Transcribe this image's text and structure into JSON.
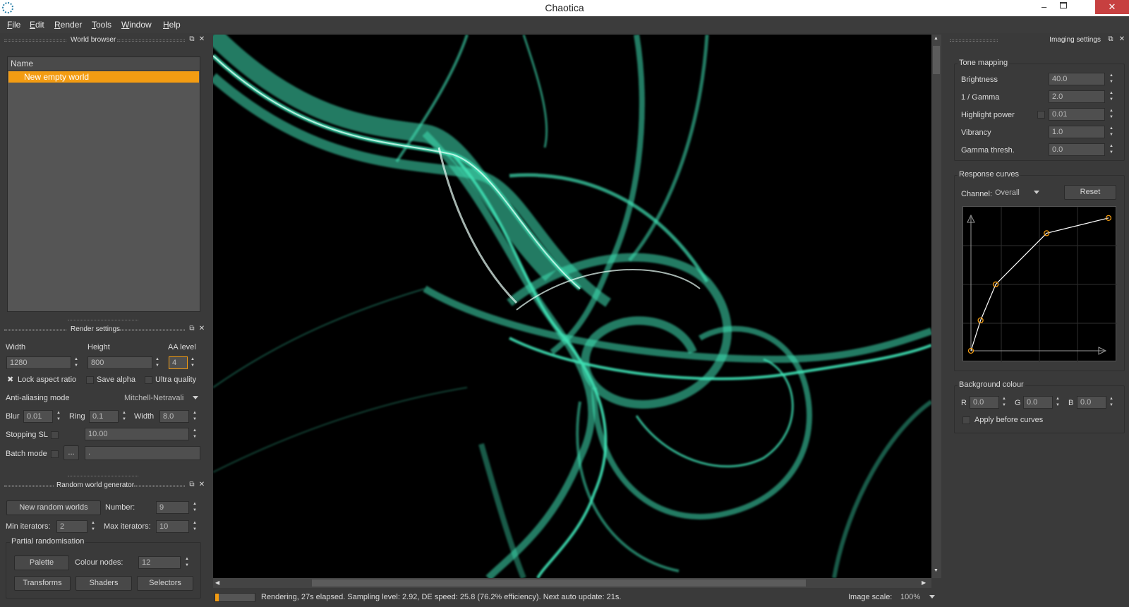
{
  "app": {
    "title": "Chaotica"
  },
  "menu": [
    "File",
    "Edit",
    "Render",
    "Tools",
    "Window",
    "Help"
  ],
  "world_browser": {
    "title": "World browser",
    "column": "Name",
    "items": [
      "New empty world"
    ]
  },
  "render_settings": {
    "title": "Render settings",
    "width_label": "Width",
    "width": "1280",
    "height_label": "Height",
    "height": "800",
    "aa_label": "AA level",
    "aa": "4",
    "lock_aspect": "Lock aspect ratio",
    "save_alpha": "Save alpha",
    "ultra_quality": "Ultra quality",
    "aa_mode_label": "Anti-aliasing mode",
    "aa_mode": "Mitchell-Netravali",
    "blur_label": "Blur",
    "blur": "0.01",
    "ring_label": "Ring",
    "ring": "0.1",
    "fwidth_label": "Width",
    "fwidth": "8.0",
    "stopping_label": "Stopping SL",
    "stopping": "10.00",
    "batch_label": "Batch mode",
    "batch_btn": "...",
    "batch_path": "."
  },
  "random_gen": {
    "title": "Random world generator",
    "new_btn": "New random worlds",
    "number_label": "Number:",
    "number": "9",
    "min_label": "Min iterators:",
    "min": "2",
    "max_label": "Max iterators:",
    "max": "10",
    "partial_title": "Partial randomisation",
    "palette": "Palette",
    "colour_nodes_label": "Colour nodes:",
    "colour_nodes": "12",
    "transforms": "Transforms",
    "shaders": "Shaders",
    "selectors": "Selectors"
  },
  "status": {
    "text": "Rendering, 27s elapsed. Sampling level: 2.92, DE speed: 25.8 (76.2% efficiency). Next auto update: 21s.",
    "scale_label": "Image scale:",
    "scale": "100%",
    "progress": 0.09
  },
  "imaging": {
    "title": "Imaging settings",
    "tone_title": "Tone mapping",
    "brightness_label": "Brightness",
    "brightness": "40.0",
    "gamma_label": "1 / Gamma",
    "gamma": "2.0",
    "highlight_label": "Highlight power",
    "highlight": "0.01",
    "vibrancy_label": "Vibrancy",
    "vibrancy": "1.0",
    "gthresh_label": "Gamma thresh.",
    "gthresh": "0.0",
    "curves_title": "Response curves",
    "channel_label": "Channel:",
    "channel": "Overall",
    "reset": "Reset",
    "curve_points": [
      [
        0,
        0
      ],
      [
        0.07,
        0.22
      ],
      [
        0.18,
        0.48
      ],
      [
        0.55,
        0.85
      ],
      [
        1,
        0.96
      ]
    ],
    "bg_title": "Background colour",
    "r_label": "R",
    "r": "0.0",
    "g_label": "G",
    "g": "0.0",
    "b_label": "B",
    "b": "0.0",
    "apply_before": "Apply before curves"
  },
  "colors": {
    "accent": "#f39c12",
    "flame": "#3fe0b4"
  }
}
